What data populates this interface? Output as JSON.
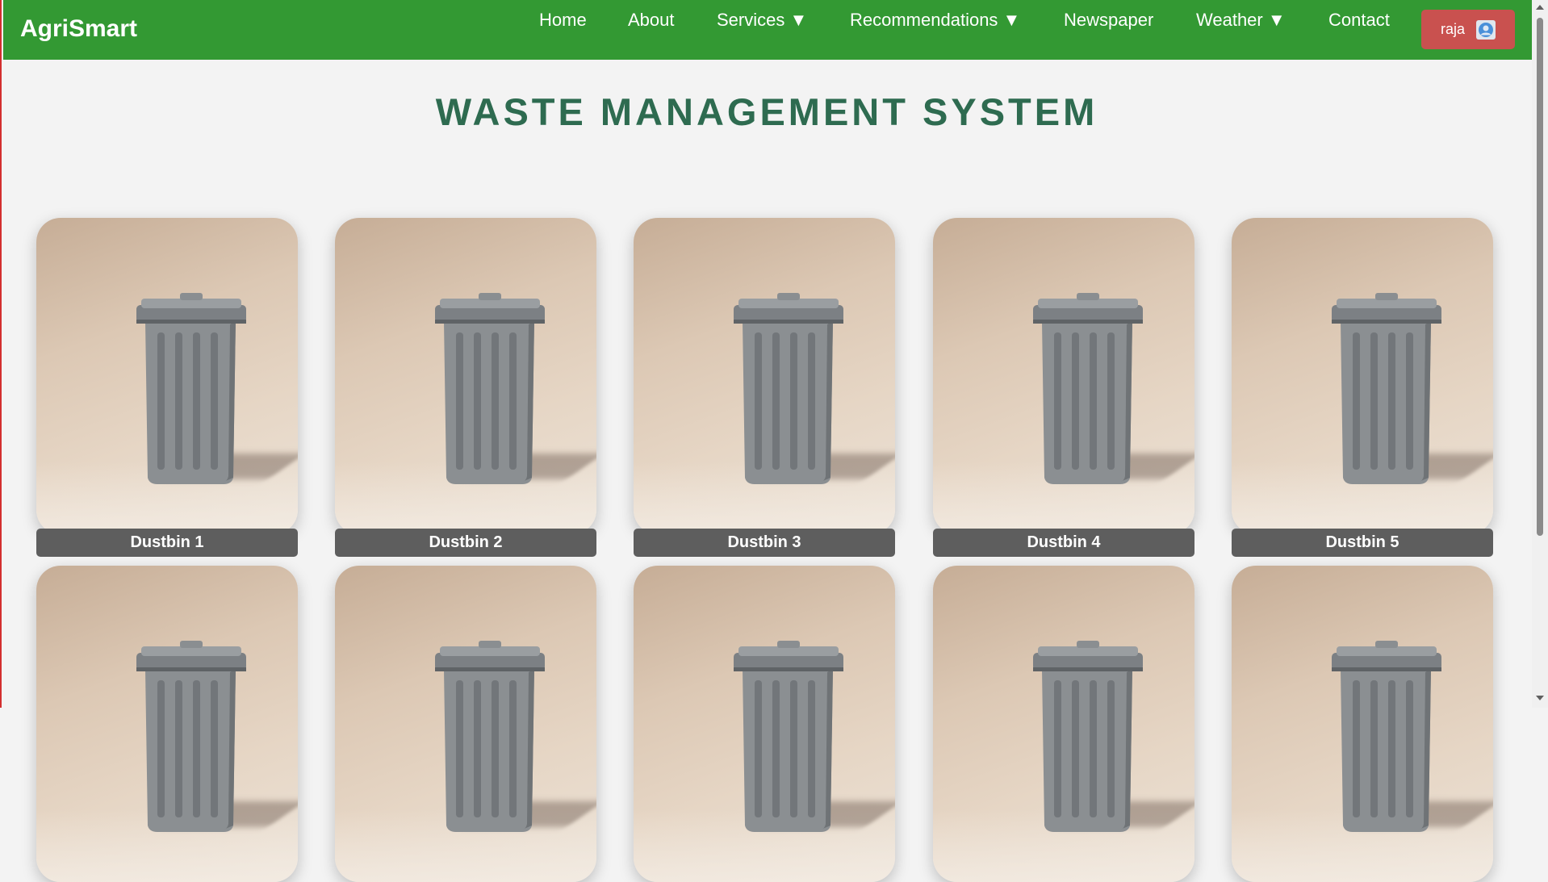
{
  "nav": {
    "logo": "AgriSmart",
    "links": [
      "Home",
      "About",
      "Services ▼",
      "Recommendations ▼",
      "Newspaper",
      "Weather ▼",
      "Contact"
    ],
    "user": "raja"
  },
  "page": {
    "title": "WASTE MANAGEMENT SYSTEM"
  },
  "cards": [
    {
      "label": "Dustbin 1"
    },
    {
      "label": "Dustbin 2"
    },
    {
      "label": "Dustbin 3"
    },
    {
      "label": "Dustbin 4"
    },
    {
      "label": "Dustbin 5"
    },
    {
      "label": ""
    },
    {
      "label": ""
    },
    {
      "label": ""
    },
    {
      "label": ""
    },
    {
      "label": ""
    }
  ],
  "colors": {
    "navbar": "#339933",
    "title": "#2e6b50",
    "user_button": "#c9514f",
    "card_label": "#5e5e5e"
  },
  "icons": {
    "user": "user-avatar-icon",
    "dustbin": "dustbin-image"
  }
}
